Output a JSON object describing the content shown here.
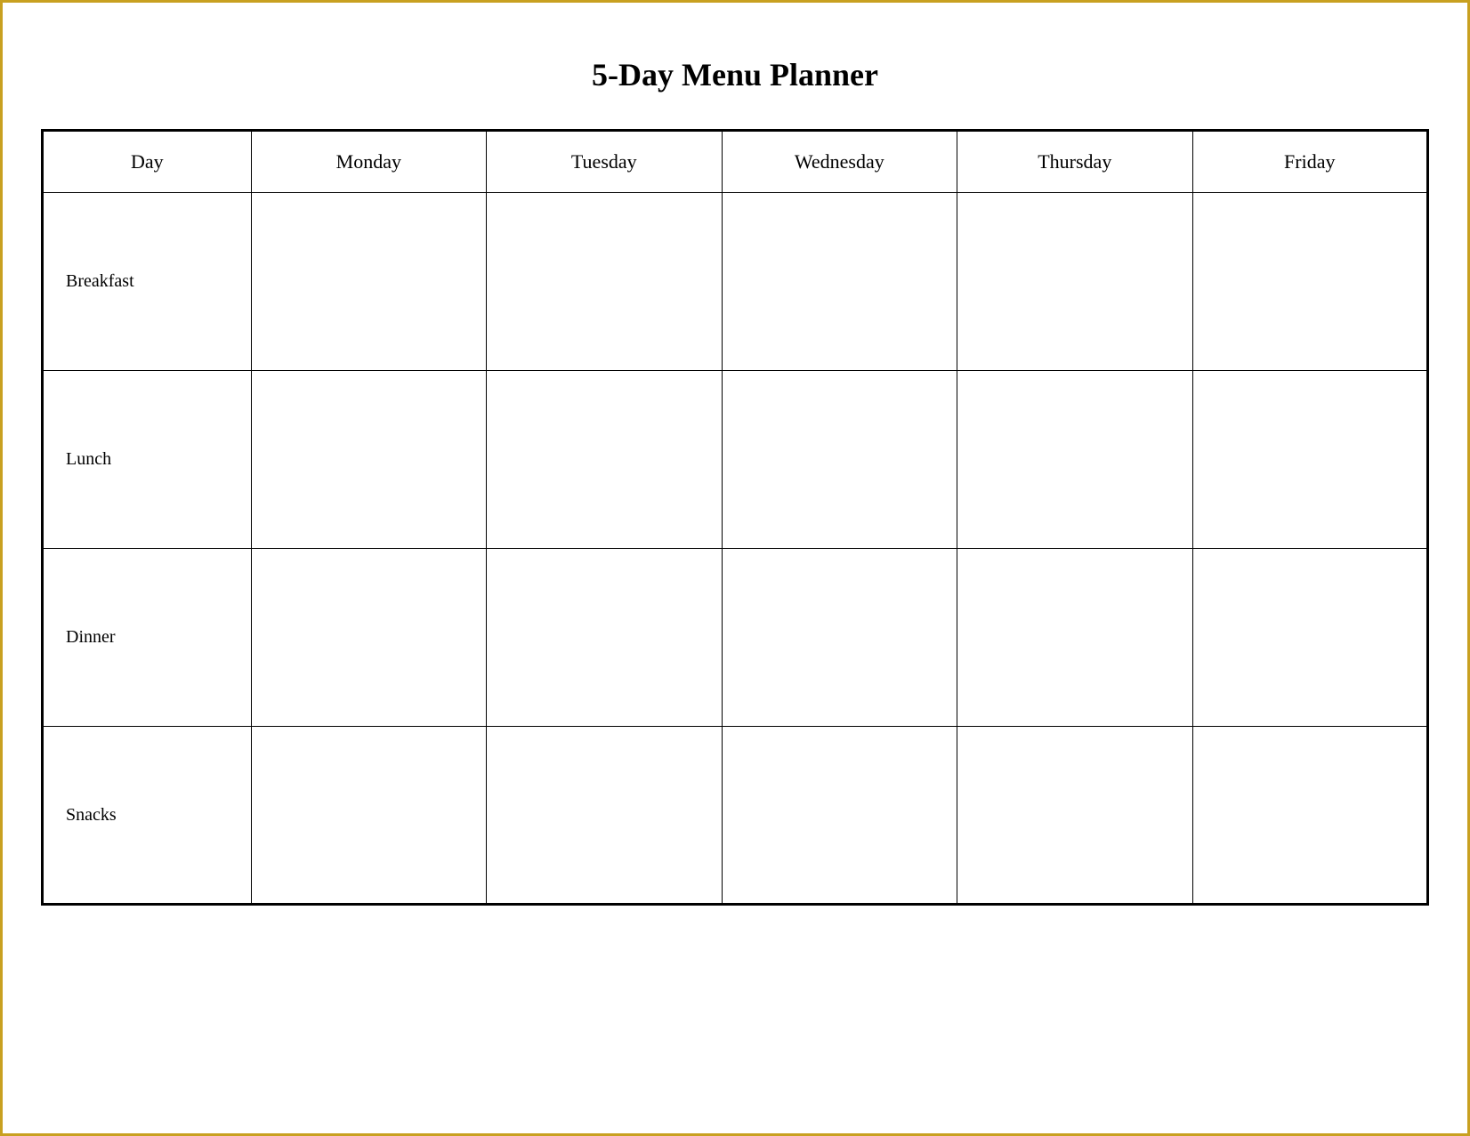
{
  "title": "5-Day Menu Planner",
  "table": {
    "headers": [
      "Day",
      "Monday",
      "Tuesday",
      "Wednesday",
      "Thursday",
      "Friday"
    ],
    "rows": [
      {
        "meal": "Breakfast"
      },
      {
        "meal": "Lunch"
      },
      {
        "meal": "Dinner"
      },
      {
        "meal": "Snacks"
      }
    ]
  }
}
